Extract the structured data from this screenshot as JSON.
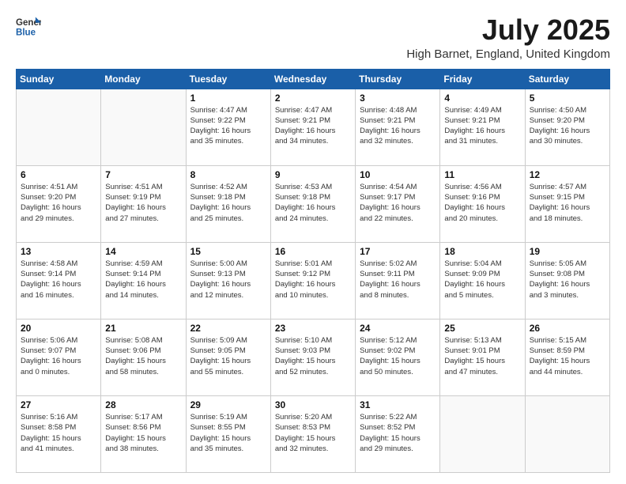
{
  "header": {
    "logo_general": "General",
    "logo_blue": "Blue",
    "title": "July 2025",
    "subtitle": "High Barnet, England, United Kingdom"
  },
  "weekdays": [
    "Sunday",
    "Monday",
    "Tuesday",
    "Wednesday",
    "Thursday",
    "Friday",
    "Saturday"
  ],
  "weeks": [
    [
      {
        "day": "",
        "detail": ""
      },
      {
        "day": "",
        "detail": ""
      },
      {
        "day": "1",
        "detail": "Sunrise: 4:47 AM\nSunset: 9:22 PM\nDaylight: 16 hours\nand 35 minutes."
      },
      {
        "day": "2",
        "detail": "Sunrise: 4:47 AM\nSunset: 9:21 PM\nDaylight: 16 hours\nand 34 minutes."
      },
      {
        "day": "3",
        "detail": "Sunrise: 4:48 AM\nSunset: 9:21 PM\nDaylight: 16 hours\nand 32 minutes."
      },
      {
        "day": "4",
        "detail": "Sunrise: 4:49 AM\nSunset: 9:21 PM\nDaylight: 16 hours\nand 31 minutes."
      },
      {
        "day": "5",
        "detail": "Sunrise: 4:50 AM\nSunset: 9:20 PM\nDaylight: 16 hours\nand 30 minutes."
      }
    ],
    [
      {
        "day": "6",
        "detail": "Sunrise: 4:51 AM\nSunset: 9:20 PM\nDaylight: 16 hours\nand 29 minutes."
      },
      {
        "day": "7",
        "detail": "Sunrise: 4:51 AM\nSunset: 9:19 PM\nDaylight: 16 hours\nand 27 minutes."
      },
      {
        "day": "8",
        "detail": "Sunrise: 4:52 AM\nSunset: 9:18 PM\nDaylight: 16 hours\nand 25 minutes."
      },
      {
        "day": "9",
        "detail": "Sunrise: 4:53 AM\nSunset: 9:18 PM\nDaylight: 16 hours\nand 24 minutes."
      },
      {
        "day": "10",
        "detail": "Sunrise: 4:54 AM\nSunset: 9:17 PM\nDaylight: 16 hours\nand 22 minutes."
      },
      {
        "day": "11",
        "detail": "Sunrise: 4:56 AM\nSunset: 9:16 PM\nDaylight: 16 hours\nand 20 minutes."
      },
      {
        "day": "12",
        "detail": "Sunrise: 4:57 AM\nSunset: 9:15 PM\nDaylight: 16 hours\nand 18 minutes."
      }
    ],
    [
      {
        "day": "13",
        "detail": "Sunrise: 4:58 AM\nSunset: 9:14 PM\nDaylight: 16 hours\nand 16 minutes."
      },
      {
        "day": "14",
        "detail": "Sunrise: 4:59 AM\nSunset: 9:14 PM\nDaylight: 16 hours\nand 14 minutes."
      },
      {
        "day": "15",
        "detail": "Sunrise: 5:00 AM\nSunset: 9:13 PM\nDaylight: 16 hours\nand 12 minutes."
      },
      {
        "day": "16",
        "detail": "Sunrise: 5:01 AM\nSunset: 9:12 PM\nDaylight: 16 hours\nand 10 minutes."
      },
      {
        "day": "17",
        "detail": "Sunrise: 5:02 AM\nSunset: 9:11 PM\nDaylight: 16 hours\nand 8 minutes."
      },
      {
        "day": "18",
        "detail": "Sunrise: 5:04 AM\nSunset: 9:09 PM\nDaylight: 16 hours\nand 5 minutes."
      },
      {
        "day": "19",
        "detail": "Sunrise: 5:05 AM\nSunset: 9:08 PM\nDaylight: 16 hours\nand 3 minutes."
      }
    ],
    [
      {
        "day": "20",
        "detail": "Sunrise: 5:06 AM\nSunset: 9:07 PM\nDaylight: 16 hours\nand 0 minutes."
      },
      {
        "day": "21",
        "detail": "Sunrise: 5:08 AM\nSunset: 9:06 PM\nDaylight: 15 hours\nand 58 minutes."
      },
      {
        "day": "22",
        "detail": "Sunrise: 5:09 AM\nSunset: 9:05 PM\nDaylight: 15 hours\nand 55 minutes."
      },
      {
        "day": "23",
        "detail": "Sunrise: 5:10 AM\nSunset: 9:03 PM\nDaylight: 15 hours\nand 52 minutes."
      },
      {
        "day": "24",
        "detail": "Sunrise: 5:12 AM\nSunset: 9:02 PM\nDaylight: 15 hours\nand 50 minutes."
      },
      {
        "day": "25",
        "detail": "Sunrise: 5:13 AM\nSunset: 9:01 PM\nDaylight: 15 hours\nand 47 minutes."
      },
      {
        "day": "26",
        "detail": "Sunrise: 5:15 AM\nSunset: 8:59 PM\nDaylight: 15 hours\nand 44 minutes."
      }
    ],
    [
      {
        "day": "27",
        "detail": "Sunrise: 5:16 AM\nSunset: 8:58 PM\nDaylight: 15 hours\nand 41 minutes."
      },
      {
        "day": "28",
        "detail": "Sunrise: 5:17 AM\nSunset: 8:56 PM\nDaylight: 15 hours\nand 38 minutes."
      },
      {
        "day": "29",
        "detail": "Sunrise: 5:19 AM\nSunset: 8:55 PM\nDaylight: 15 hours\nand 35 minutes."
      },
      {
        "day": "30",
        "detail": "Sunrise: 5:20 AM\nSunset: 8:53 PM\nDaylight: 15 hours\nand 32 minutes."
      },
      {
        "day": "31",
        "detail": "Sunrise: 5:22 AM\nSunset: 8:52 PM\nDaylight: 15 hours\nand 29 minutes."
      },
      {
        "day": "",
        "detail": ""
      },
      {
        "day": "",
        "detail": ""
      }
    ]
  ]
}
